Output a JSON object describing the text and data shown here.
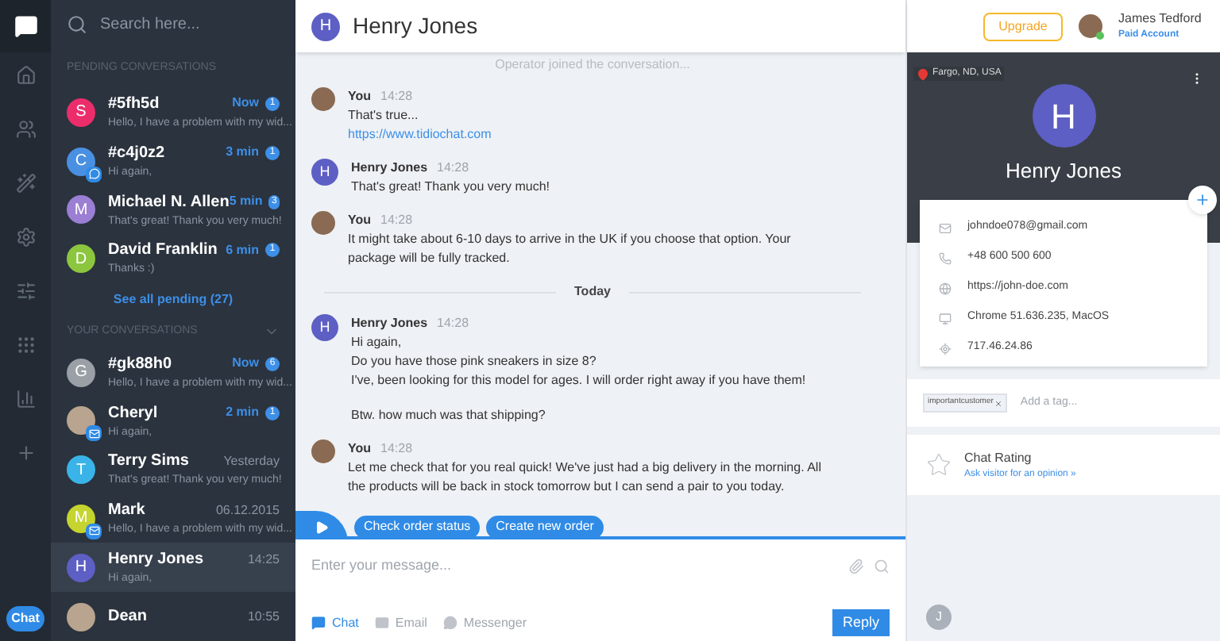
{
  "sidebar": {
    "search": {
      "placeholder": "Search here..."
    },
    "chat_bubble": "Chat",
    "pending": {
      "heading": "PENDING CONVERSATIONS",
      "link": "See all pending (27)",
      "items": [
        {
          "initial": "S",
          "color": "#ec2d6b",
          "name": "#5fh5d",
          "preview": "Hello, I have a problem with my wid...",
          "time": "Now",
          "unread": "1",
          "selected": false
        },
        {
          "initial": "C",
          "color": "#4a90e2",
          "name": "#c4j0z2",
          "preview": "Hi again,",
          "time": "3 min",
          "unread": "1",
          "messenger_badge": true,
          "selected": false
        },
        {
          "initial": "M",
          "color": "#9b7fd4",
          "name": "Michael N. Allen",
          "preview": "That's great! Thank you very much!",
          "time": "5 min",
          "unread": "3",
          "selected": false
        },
        {
          "initial": "D",
          "color": "#8cc63f",
          "name": "David Franklin",
          "preview": "Thanks :)",
          "time": "6 min",
          "unread": "1",
          "selected": false
        }
      ]
    },
    "yours": {
      "heading": "YOUR CONVERSATIONS",
      "expanded": true,
      "items": [
        {
          "initial": "G",
          "color": "#9aa0a6",
          "name": "#gk88h0",
          "preview": "Hello, I have a problem with my wid...",
          "time": "Now",
          "unread": "6",
          "selected": false
        },
        {
          "kind": "photo",
          "name": "Cheryl",
          "preview": "Hi again,",
          "time": "2 min",
          "unread": "1",
          "email_badge": true,
          "selected": false
        },
        {
          "initial": "T",
          "color": "#3ab4e8",
          "name": "Terry Sims",
          "preview": "That's great! Thank you very much!",
          "time": "Yesterday",
          "selected": false
        },
        {
          "initial": "M",
          "color": "#c5d42e",
          "name": "Mark",
          "preview": "Hello, I have a problem with my wid...",
          "time": "06.12.2015",
          "email_badge": true,
          "selected": false
        },
        {
          "initial": "H",
          "color": "#5d5fc4",
          "name": "Henry Jones",
          "preview": "Hi again,",
          "time": "14:25",
          "selected": true
        },
        {
          "kind": "photo",
          "name": "Dean",
          "time": "10:55",
          "selected": false
        }
      ]
    }
  },
  "chat": {
    "title": "Henry Jones",
    "initial": "H",
    "system_note": "Operator joined the conversation...",
    "messages": [
      {
        "kind": "message",
        "sender": "You",
        "is_agent": true,
        "time": "14:28",
        "lines": [
          "That's true..."
        ],
        "link": "https://www.tidiochat.com"
      },
      {
        "kind": "message",
        "sender": "Henry Jones",
        "is_agent": false,
        "initial": "H",
        "time": "14:28",
        "lines": [
          "That's great! Thank you very much!"
        ]
      },
      {
        "kind": "message",
        "sender": "You",
        "is_agent": true,
        "time": "14:28",
        "lines": [
          "It might take about 6-10 days to arrive in the UK if you choose that option. Your package will be fully tracked."
        ]
      },
      {
        "kind": "divider",
        "label": "Today"
      },
      {
        "kind": "message",
        "sender": "Henry Jones",
        "is_agent": false,
        "initial": "H",
        "time": "14:28",
        "lines": [
          "Hi again,",
          "Do you have those pink sneakers in size 8?",
          "I've, been looking for this model for ages. I will order right away if you have them!"
        ],
        "postscript": "Btw. how much was that shipping?"
      },
      {
        "kind": "message",
        "sender": "You",
        "is_agent": true,
        "time": "14:28",
        "lines": [
          "Let me check that for you real quick! We've just had a big delivery in the morning. All the products will be back in stock tomorrow but I can send a pair to you today."
        ]
      }
    ],
    "quick_replies": [
      "Check order status",
      "Create new order"
    ],
    "input": {
      "placeholder": "Enter your message..."
    },
    "channels": [
      {
        "kind": "chat",
        "label": "Chat",
        "selected": true
      },
      {
        "kind": "email",
        "label": "Email",
        "selected": false
      },
      {
        "kind": "messenger",
        "label": "Messenger",
        "selected": false
      }
    ],
    "reply_button": "Reply"
  },
  "topbar": {
    "upgrade": "Upgrade",
    "user": "James Tedford",
    "plan": "Paid Account",
    "online": true
  },
  "visitor": {
    "location": "Fargo, ND, USA",
    "initial": "H",
    "name": "Henry Jones",
    "details": [
      {
        "kind": "email",
        "value": "johndoe078@gmail.com"
      },
      {
        "kind": "phone",
        "value": "+48 600 500 600"
      },
      {
        "kind": "web",
        "value": "https://john-doe.com"
      },
      {
        "kind": "browser",
        "value": "Chrome 51.636.235, MacOS"
      },
      {
        "kind": "ip",
        "value": "717.46.24.86"
      }
    ],
    "tags": [
      "importantcustomer"
    ],
    "tag_placeholder": "Add a tag...",
    "rating": {
      "title": "Chat Rating",
      "link": "Ask visitor for an opinion »"
    },
    "operator_initial": "J"
  }
}
